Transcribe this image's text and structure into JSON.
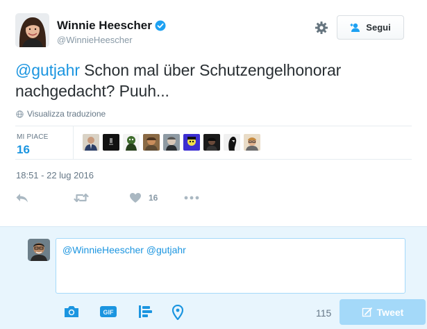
{
  "author": {
    "name": "Winnie Heescher",
    "handle": "@WinnieHeescher"
  },
  "header": {
    "follow_label": "Segui"
  },
  "tweet": {
    "mention": "@gutjahr",
    "text": " Schon mal über Schutzengelhonorar nachgedacht? Puuh...",
    "translate_label": "Visualizza traduzione",
    "timestamp": "18:51 - 22 lug 2016"
  },
  "stats": {
    "likes_label": "MI PIACE",
    "likes_count": "16"
  },
  "actions": {
    "like_count": "16"
  },
  "reply": {
    "input_value": "@WinnieHeescher @gutjahr",
    "char_count": "115",
    "tweet_label": "Tweet"
  },
  "colors": {
    "accent": "#1b95e0",
    "tweet_button_disabled": "#a4d9f9",
    "reply_background": "#e8f5fd"
  },
  "icons": [
    "verified-icon",
    "gear-icon",
    "follow-user-icon",
    "globe-icon",
    "reply-icon",
    "retweet-icon",
    "heart-icon",
    "more-icon",
    "camera-icon",
    "gif-icon",
    "poll-icon",
    "location-icon",
    "compose-icon"
  ]
}
